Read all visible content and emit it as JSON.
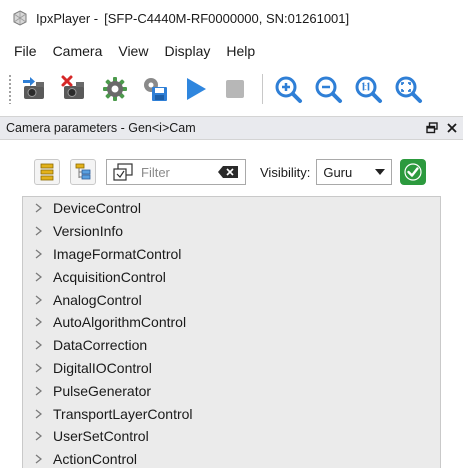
{
  "window": {
    "app_name": "IpxPlayer -",
    "detail": "[SFP-C4440M-RF0000000, SN:01261001]"
  },
  "menu": [
    "File",
    "Camera",
    "View",
    "Display",
    "Help"
  ],
  "toolbar": {
    "icons": [
      "camera-connect-icon",
      "camera-disconnect-icon",
      "settings-gear-icon",
      "save-settings-icon",
      "play-icon",
      "stop-icon",
      "zoom-in-icon",
      "zoom-out-icon",
      "zoom-actual-size-icon",
      "zoom-fit-icon"
    ]
  },
  "panel": {
    "title": "Camera parameters - Gen<i>Cam",
    "float_icon": "float-window-icon",
    "close_icon": "close-icon"
  },
  "params_toolbar": {
    "filter_placeholder": "Filter",
    "visibility_label": "Visibility:",
    "visibility_value": "Guru"
  },
  "tree_items": [
    "DeviceControl",
    "VersionInfo",
    "ImageFormatControl",
    "AcquisitionControl",
    "AnalogControl",
    "AutoAlgorithmControl",
    "DataCorrection",
    "DigitalIOControl",
    "PulseGenerator",
    "TransportLayerControl",
    "UserSetControl",
    "ActionControl"
  ],
  "colors": {
    "accent_blue": "#2f7fd6",
    "apply_green": "#2c9a3e",
    "panel_header_bg": "#e9eaee",
    "tree_bg": "#ebebeb"
  }
}
